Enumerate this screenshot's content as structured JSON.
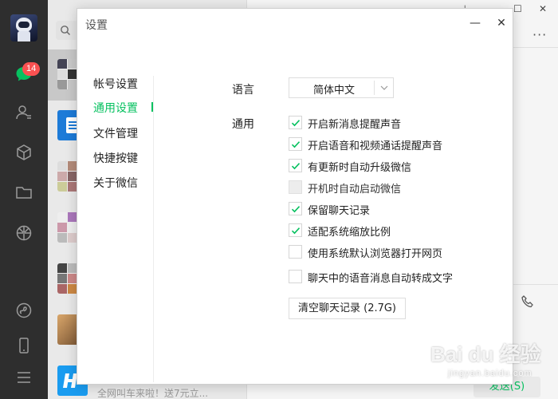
{
  "app": {
    "badge_count": "14"
  },
  "dialog": {
    "title": "设置",
    "minimize_symbol": "—",
    "close_symbol": "✕"
  },
  "nav": {
    "items": [
      {
        "label": "帐号设置"
      },
      {
        "label": "通用设置",
        "active": true
      },
      {
        "label": "文件管理"
      },
      {
        "label": "快捷按键"
      },
      {
        "label": "关于微信"
      }
    ]
  },
  "general": {
    "language_label": "语言",
    "language_value": "简体中文",
    "section_label": "通用",
    "options": [
      {
        "label": "开启新消息提醒声音",
        "checked": true
      },
      {
        "label": "开启语音和视频通话提醒声音",
        "checked": true
      },
      {
        "label": "有更新时自动升级微信",
        "checked": true
      },
      {
        "label": "开机时自动启动微信",
        "checked": false,
        "disabled": true
      },
      {
        "label": "保留聊天记录",
        "checked": true
      },
      {
        "label": "适配系统缩放比例",
        "checked": true
      },
      {
        "label": "使用系统默认浏览器打开网页",
        "checked": false
      },
      {
        "label": "聊天中的语音消息自动转成文字",
        "checked": false
      }
    ],
    "clear_button": "清空聊天记录 (2.7G)"
  },
  "chat": {
    "last_message": "全网叫车来啦！送7元立...",
    "send_button": "发送(S)",
    "more_symbol": "···"
  },
  "colors": {
    "accent": "#07c160",
    "sidebar": "#2e2e2e",
    "badge": "#fa5151"
  },
  "watermark": {
    "text": "Bai du 经验",
    "sub": "jingyan.baidu.com"
  }
}
